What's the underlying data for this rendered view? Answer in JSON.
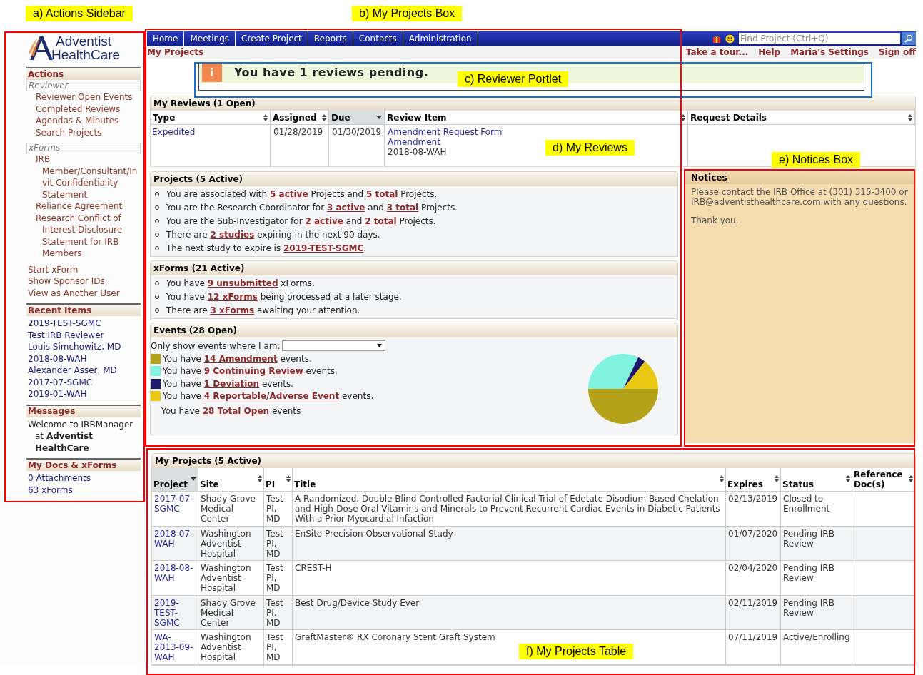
{
  "annotations": [
    {
      "kind": "sidebar",
      "label": "a) Actions Sidebar"
    },
    {
      "kind": "projects_box",
      "label": "b) My Projects Box"
    },
    {
      "kind": "reviewer_portlet",
      "label": "c) Reviewer Portlet"
    },
    {
      "kind": "my_reviews",
      "label": "d) My Reviews"
    },
    {
      "kind": "notices_box",
      "label": "e) Notices Box"
    },
    {
      "kind": "projects_table",
      "label": "f) My Projects Table"
    }
  ],
  "sidebar": {
    "logo": {
      "line1": "Adventist",
      "line2": "HealthCare"
    },
    "actions": {
      "title": "Actions",
      "groups": [
        {
          "title": "Reviewer",
          "items": [
            "Reviewer Open Events",
            "Completed Reviews",
            "Agendas & Minutes",
            "Search Projects"
          ]
        },
        {
          "title": "xForms",
          "items": [
            "IRB Member/Consultant/Invit Confidentiality Statement",
            "Reliance Agreement",
            "Research Conflict of Interest Disclosure Statement for IRB Members"
          ]
        }
      ],
      "links": [
        "Start xForm",
        "Show Sponsor IDs",
        "View as Another User"
      ]
    },
    "recent_items": {
      "title": "Recent Items",
      "items": [
        "2019-TEST-SGMC",
        "Test IRB Reviewer",
        "Louis Simchowitz, MD",
        "2018-08-WAH",
        "Alexander Asser, MD",
        "2017-07-SGMC",
        "2019-01-WAH"
      ]
    },
    "messages": {
      "title": "Messages",
      "text": "Welcome to IRBManager at **Adventist HealthCare**"
    },
    "my_docs": {
      "title": "My Docs & xForms",
      "items": [
        "0 Attachments",
        "63 xForms"
      ]
    }
  },
  "nav": {
    "tabs": [
      "Home",
      "Meetings",
      "Create Project",
      "Reports",
      "Contacts",
      "Administration"
    ],
    "search": {
      "placeholder": "Find Project (Ctrl+Q)"
    }
  },
  "subbar": {
    "page_title": "My Projects",
    "links": [
      "Take a tour...",
      "Help",
      "Maria's Settings",
      "Sign off"
    ]
  },
  "reviewer_portlet": {
    "icon": "i",
    "message": "You have 1 reviews pending."
  },
  "my_reviews": {
    "title": "My Reviews (1 Open)",
    "columns": [
      {
        "label": "Type",
        "sorted": false
      },
      {
        "label": "Assigned",
        "sorted": false
      },
      {
        "label": "Due",
        "sorted": true
      },
      {
        "label": "Review Item",
        "sorted": false
      },
      {
        "label": "Request Details",
        "sorted": false
      }
    ],
    "rows": [
      {
        "type": "Expedited",
        "assigned": "01/28/2019",
        "due": "01/30/2019",
        "review_item": {
          "form": "Amendment Request Form",
          "kind": "Amendment",
          "project": "2018-08-WAH"
        }
      }
    ]
  },
  "projects_summary": {
    "title": "Projects (5 Active)",
    "items": [
      {
        "parts": [
          {
            "kind": "plain",
            "text": "You are associated with "
          },
          {
            "kind": "link",
            "text": "5 active"
          },
          {
            "kind": "plain",
            "text": " Projects and "
          },
          {
            "kind": "link",
            "text": "5 total"
          },
          {
            "kind": "plain",
            "text": " Projects."
          }
        ]
      },
      {
        "parts": [
          {
            "kind": "plain",
            "text": "You are the Research Coordinator for "
          },
          {
            "kind": "link",
            "text": "3 active"
          },
          {
            "kind": "plain",
            "text": " and "
          },
          {
            "kind": "link",
            "text": "3 total"
          },
          {
            "kind": "plain",
            "text": " Projects."
          }
        ]
      },
      {
        "parts": [
          {
            "kind": "plain",
            "text": "You are the Sub-Investigator for "
          },
          {
            "kind": "link",
            "text": "2 active"
          },
          {
            "kind": "plain",
            "text": " and "
          },
          {
            "kind": "link",
            "text": "2 total"
          },
          {
            "kind": "plain",
            "text": " Projects."
          }
        ]
      },
      {
        "parts": [
          {
            "kind": "plain",
            "text": "There are "
          },
          {
            "kind": "link",
            "text": "2 studies"
          },
          {
            "kind": "plain",
            "text": " expiring in the next 90 days."
          }
        ]
      },
      {
        "parts": [
          {
            "kind": "plain",
            "text": "The next study to expire is "
          },
          {
            "kind": "link",
            "text": "2019-TEST-SGMC"
          },
          {
            "kind": "plain",
            "text": "."
          }
        ]
      }
    ]
  },
  "xforms_summary": {
    "title": "xForms (21 Active)",
    "items": [
      {
        "parts": [
          {
            "kind": "plain",
            "text": "You have "
          },
          {
            "kind": "link",
            "text": "9 unsubmitted"
          },
          {
            "kind": "plain",
            "text": " xForms."
          }
        ]
      },
      {
        "parts": [
          {
            "kind": "plain",
            "text": "You have "
          },
          {
            "kind": "link",
            "text": "12 xForms"
          },
          {
            "kind": "plain",
            "text": " being processed at a later stage."
          }
        ]
      },
      {
        "parts": [
          {
            "kind": "plain",
            "text": "There are "
          },
          {
            "kind": "link",
            "text": "3 xForms"
          },
          {
            "kind": "plain",
            "text": " awaiting your attention."
          }
        ]
      }
    ]
  },
  "events": {
    "title": "Events (28 Open)",
    "filter_label": "Only show events where I am:",
    "items": [
      {
        "color": "#b5a11a",
        "parts": [
          {
            "kind": "plain",
            "text": "You have "
          },
          {
            "kind": "link",
            "text": "14 Amendment"
          },
          {
            "kind": "plain",
            "text": " events."
          }
        ]
      },
      {
        "color": "#7ff3e0",
        "parts": [
          {
            "kind": "plain",
            "text": "You have "
          },
          {
            "kind": "link",
            "text": "9 Continuing Review"
          },
          {
            "kind": "plain",
            "text": " events."
          }
        ]
      },
      {
        "color": "#1e1a6b",
        "parts": [
          {
            "kind": "plain",
            "text": "You have "
          },
          {
            "kind": "link",
            "text": "1 Deviation"
          },
          {
            "kind": "plain",
            "text": " events."
          }
        ]
      },
      {
        "color": "#e8c812",
        "parts": [
          {
            "kind": "plain",
            "text": "You have "
          },
          {
            "kind": "link",
            "text": "4 Reportable/Adverse Event"
          },
          {
            "kind": "plain",
            "text": " events."
          }
        ]
      },
      {
        "parts": [
          {
            "kind": "plain",
            "text": "You have "
          },
          {
            "kind": "link",
            "text": "28 Total Open"
          },
          {
            "kind": "plain",
            "text": " events"
          }
        ]
      }
    ],
    "chart_data": {
      "type": "pie",
      "values": [
        50,
        32.1,
        3.6,
        14.3
      ]
    }
  },
  "notices": {
    "title": "Notices",
    "paragraphs": [
      "Please contact the IRB Office at (301) 315-3400 or IRB@adventisthealthcare.com with any questions.",
      "Thank you."
    ]
  },
  "my_projects": {
    "title": "My Projects (5 Active)",
    "columns": [
      {
        "label": "Project",
        "sorted": true
      },
      {
        "label": "Site",
        "sorted": false
      },
      {
        "label": "PI",
        "sorted": false
      },
      {
        "label": "Title",
        "sorted": false
      },
      {
        "label": "Expires",
        "sorted": false
      },
      {
        "label": "Status",
        "sorted": false
      },
      {
        "label": "Reference Doc(s)",
        "sorted": false
      }
    ],
    "rows": [
      {
        "project": "2017-07-SGMC",
        "site": "Shady Grove Medical Center",
        "pi": "Test PI, MD",
        "title": "A Randomized, Double Blind Controlled Factorial Clinical Trial of Edetate Disodium-Based Chelation and High-Dose Oral Vitamins and Minerals to Prevent Recurrent Cardiac Events in Diabetic Patients With a Prior Myocardial Infaction",
        "expires": "02/13/2019",
        "status": "Closed to Enrollment"
      },
      {
        "project": "2018-07-WAH",
        "site": "Washington Adventist Hospital",
        "pi": "Test PI, MD",
        "title": "EnSite Precision Observational Study",
        "expires": "01/07/2020",
        "status": "Pending IRB Review"
      },
      {
        "project": "2018-08-WAH",
        "site": "Washington Adventist Hospital",
        "pi": "Test PI, MD",
        "title": "CREST-H",
        "expires": "02/04/2020",
        "status": "Pending IRB Review"
      },
      {
        "project": "2019-TEST-SGMC",
        "site": "Shady Grove Medical Center",
        "pi": "Test PI, MD",
        "title": "Best Drug/Device Study Ever",
        "expires": "02/11/2019",
        "status": "Pending IRB Review"
      },
      {
        "project": "WA-2013-09-WAH",
        "site": "Washington Adventist Hospital",
        "pi": "Test PI, MD",
        "title": "GraftMaster® RX Coronary Stent Graft System",
        "expires": "07/11/2019",
        "status": "Active/Enrolling"
      }
    ]
  }
}
